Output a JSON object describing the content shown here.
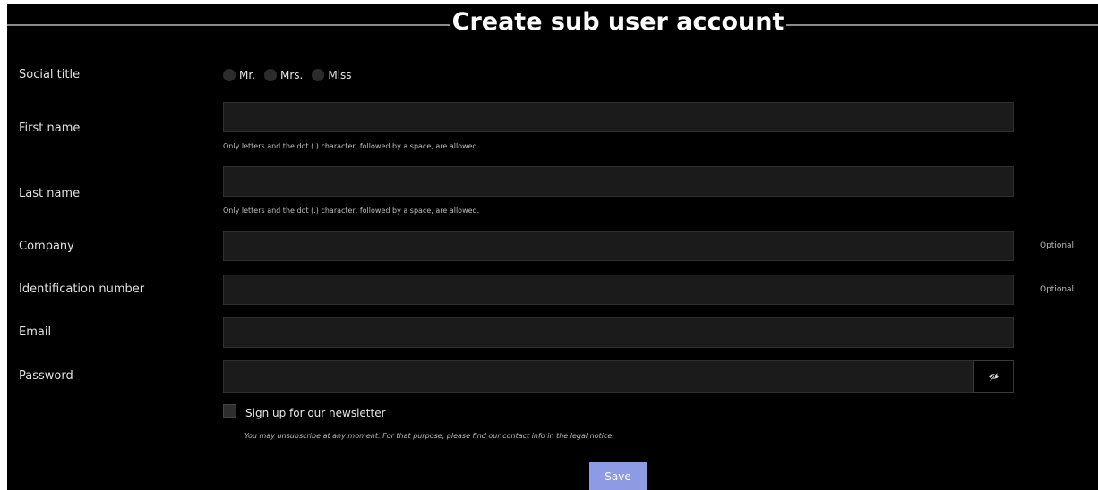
{
  "header": {
    "title": "Create sub user account"
  },
  "form": {
    "social_title": {
      "label": "Social title",
      "options": [
        "Mr.",
        "Mrs.",
        "Miss"
      ]
    },
    "first_name": {
      "label": "First name",
      "value": "",
      "hint": "Only letters and the dot (.) character, followed by a space, are allowed."
    },
    "last_name": {
      "label": "Last name",
      "value": "",
      "hint": "Only letters and the dot (.) character, followed by a space, are allowed."
    },
    "company": {
      "label": "Company",
      "value": "",
      "optional": "Optional"
    },
    "identification_number": {
      "label": "Identification number",
      "value": "",
      "optional": "Optional"
    },
    "email": {
      "label": "Email",
      "value": ""
    },
    "password": {
      "label": "Password",
      "value": "",
      "toggle_icon": "eye-slash-icon"
    },
    "newsletter": {
      "label": "Sign up for our newsletter",
      "checked": false,
      "note": "You may unsubscribe at any moment. For that purpose, please find our contact info in the legal notice."
    },
    "save_label": "Save"
  },
  "colors": {
    "background": "#000000",
    "input_background": "#1b1b1b",
    "accent": "#8c9be3"
  }
}
